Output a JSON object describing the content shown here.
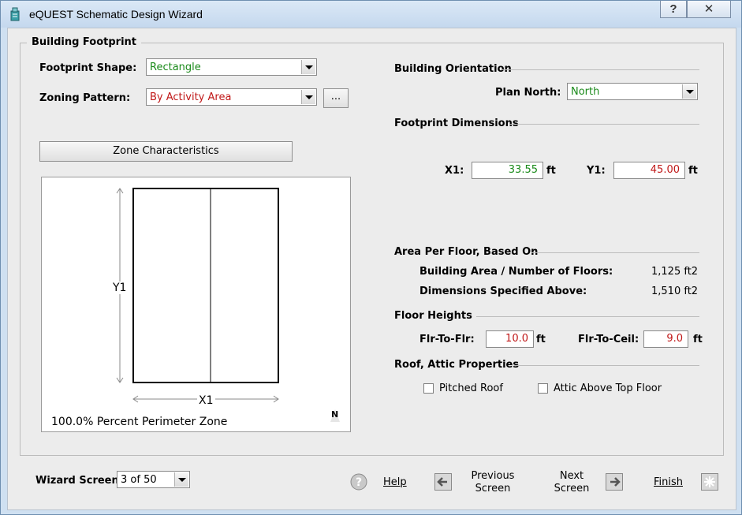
{
  "window": {
    "title": "eQUEST Schematic Design Wizard",
    "help_glyph": "?",
    "close_glyph": "✕"
  },
  "group": {
    "title": "Building Footprint"
  },
  "footprint_shape": {
    "label": "Footprint Shape:",
    "value": "Rectangle"
  },
  "zoning_pattern": {
    "label": "Zoning Pattern:",
    "value": "By Activity Area",
    "ellipsis": "..."
  },
  "zone_characteristics": {
    "label": "Zone Characteristics"
  },
  "preview": {
    "y_label": "Y1",
    "x_label": "X1",
    "north": "N",
    "perimeter_text": "100.0% Percent Perimeter Zone"
  },
  "orientation": {
    "heading": "Building Orientation",
    "plan_north_label": "Plan North:",
    "plan_north_value": "North"
  },
  "dimensions": {
    "heading": "Footprint Dimensions",
    "x1_label": "X1:",
    "x1_value": "33.55",
    "y1_label": "Y1:",
    "y1_value": "45.00",
    "unit": "ft"
  },
  "area": {
    "heading": "Area Per Floor, Based On",
    "row1_label": "Building Area / Number of Floors:",
    "row1_value": "1,125 ft2",
    "row2_label": "Dimensions Specified Above:",
    "row2_value": "1,510 ft2"
  },
  "heights": {
    "heading": "Floor Heights",
    "flr_label": "Flr-To-Flr:",
    "flr_value": "10.0",
    "ceil_label": "Flr-To-Ceil:",
    "ceil_value": "9.0",
    "unit": "ft"
  },
  "roof": {
    "heading": "Roof, Attic Properties",
    "pitched_label": "Pitched Roof",
    "pitched_checked": false,
    "attic_label": "Attic Above Top Floor",
    "attic_checked": false
  },
  "footer": {
    "wizard_screen_label": "Wizard Screen",
    "wizard_screen_value": "3 of 50",
    "help": "Help",
    "previous_line1": "Previous",
    "previous_line2": "Screen",
    "next_line1": "Next",
    "next_line2": "Screen",
    "finish": "Finish"
  },
  "colors": {
    "green": "#1a8a1a",
    "red": "#c01818"
  }
}
